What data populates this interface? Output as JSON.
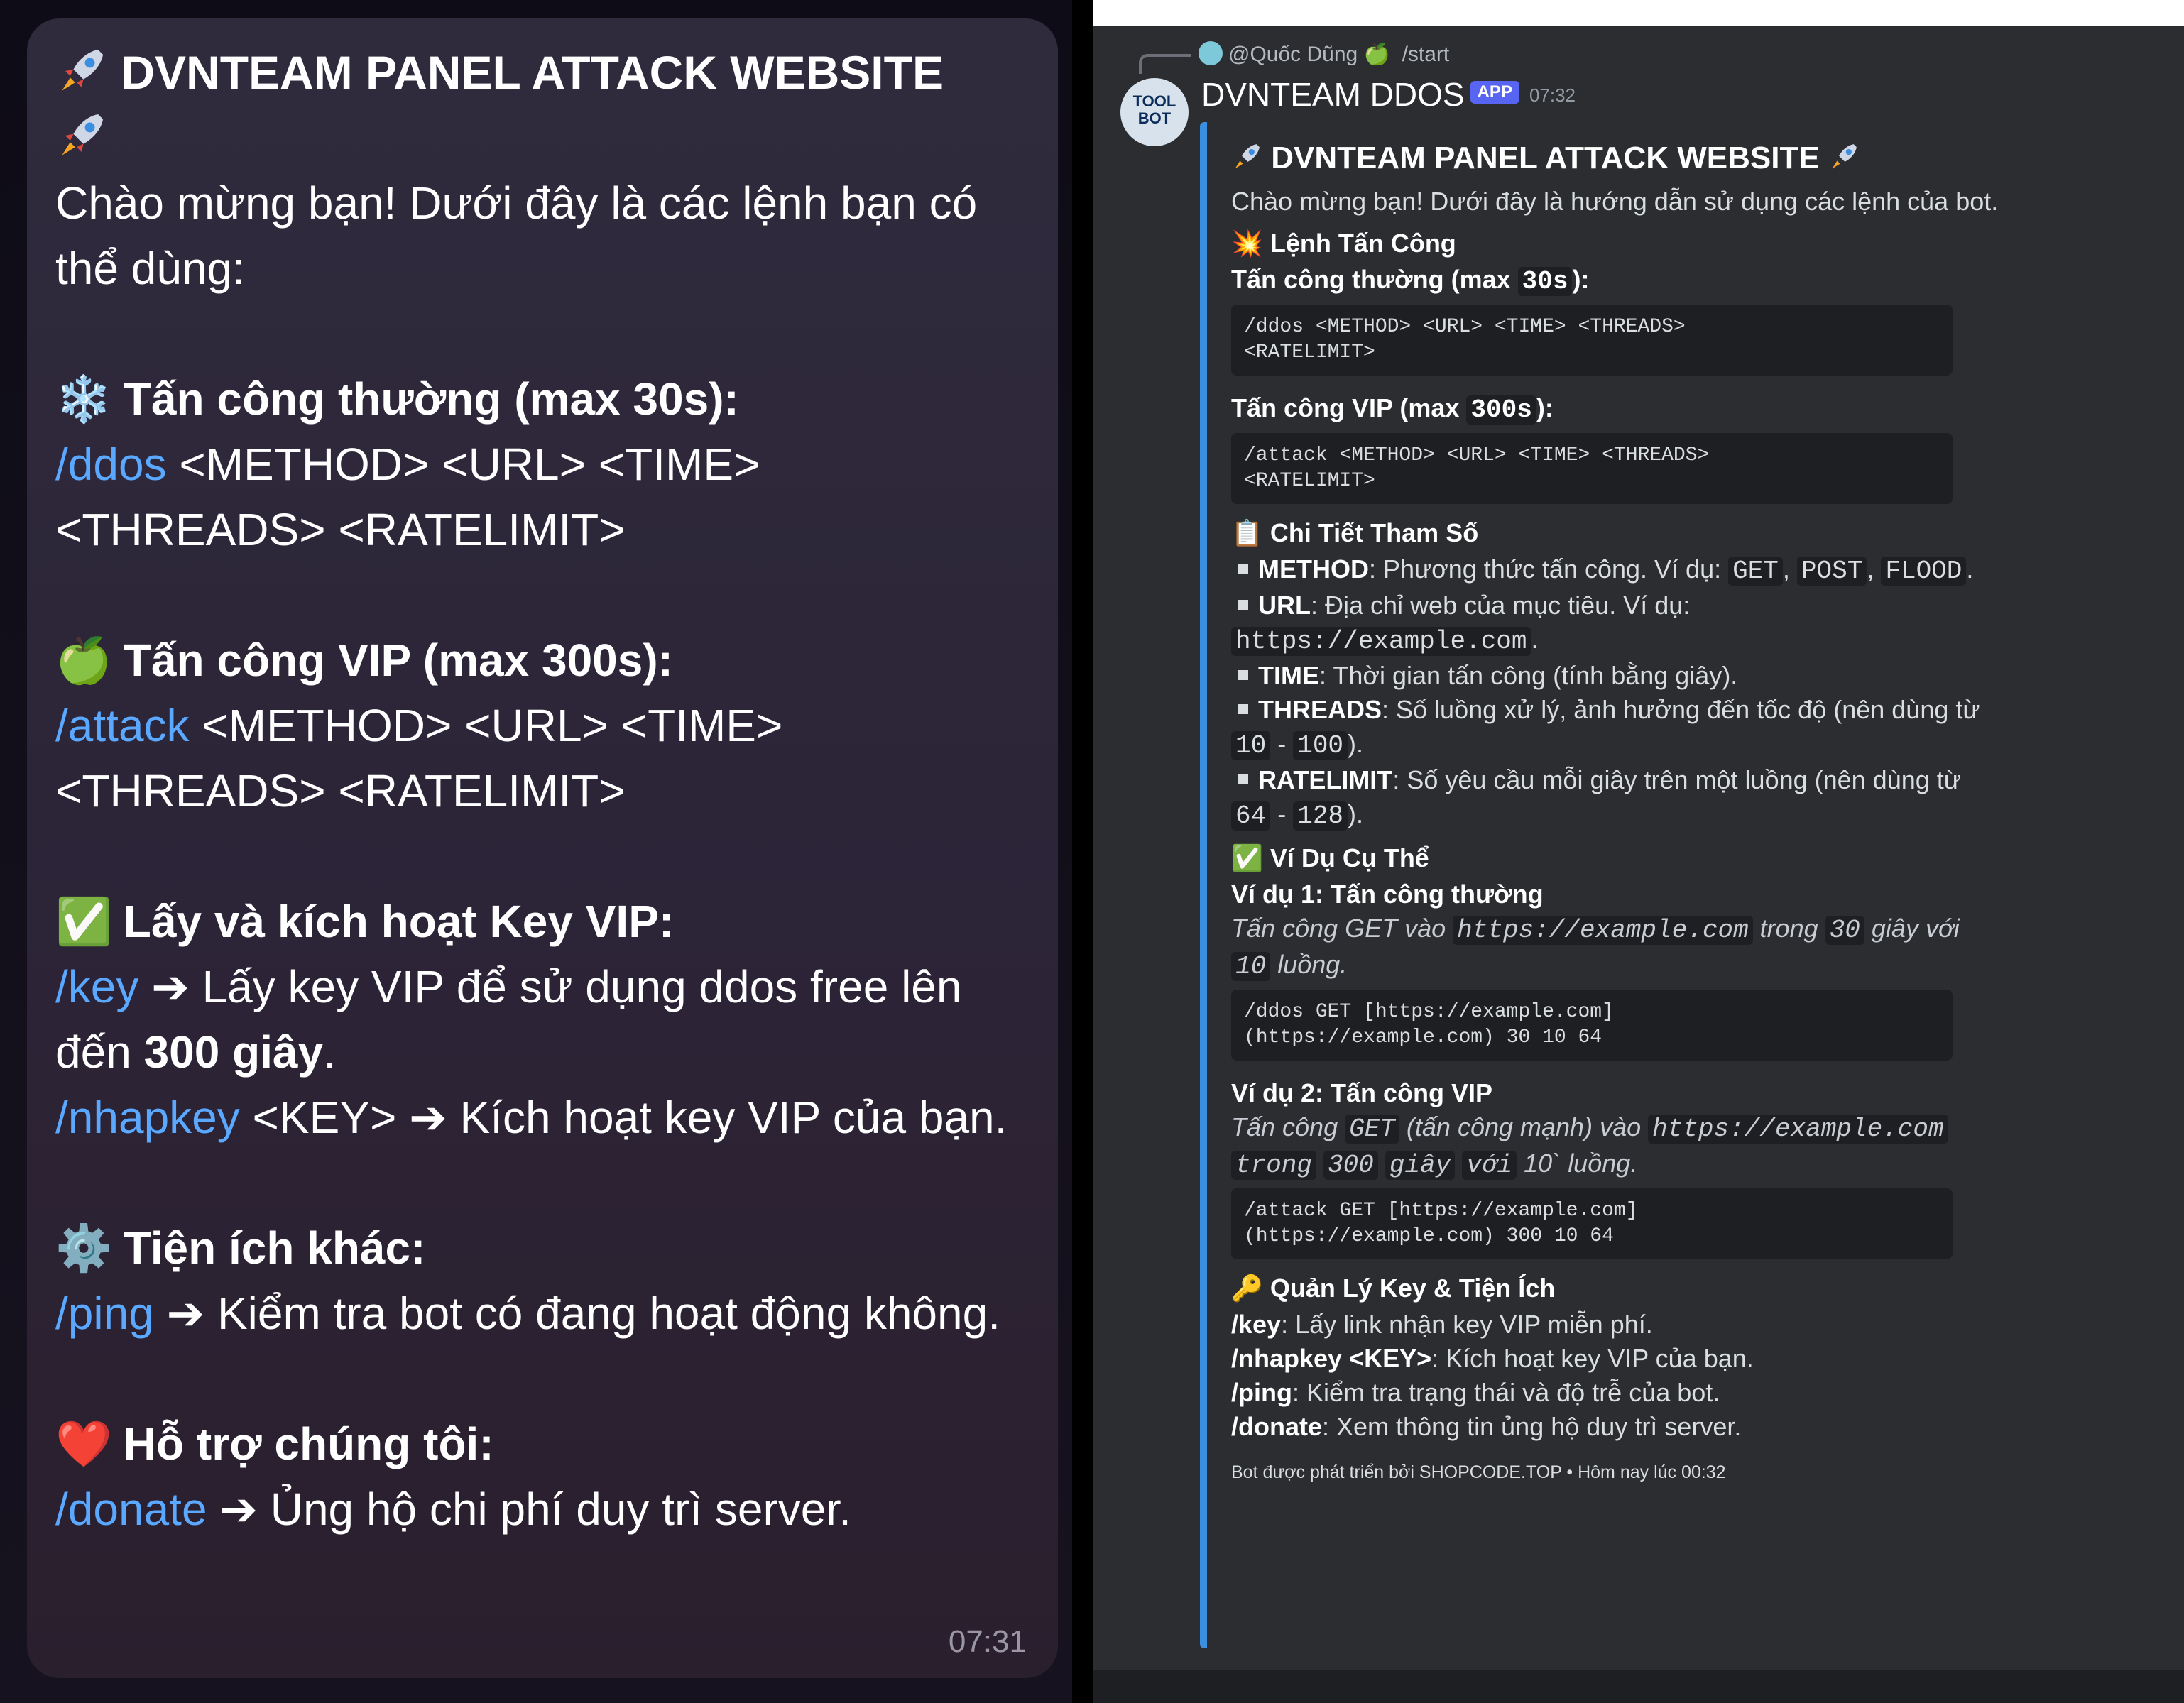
{
  "telegram": {
    "title": "DVNTEAM PANEL ATTACK WEBSITE",
    "intro": "Chào mừng bạn! Dưới đây là các lệnh bạn có thể dùng:",
    "normal": {
      "emoji": "❄️",
      "heading": "Tấn công thường (max 30s):",
      "cmd": "/ddos",
      "args": " <METHOD> <URL> <TIME> <THREADS> <RATELIMIT>"
    },
    "vip": {
      "emoji": "🍏",
      "heading": "Tấn công VIP (max 300s):",
      "cmd": "/attack",
      "args": " <METHOD> <URL> <TIME> <THREADS> <RATELIMIT>"
    },
    "key": {
      "emoji": "✅",
      "heading": "Lấy và kích hoạt Key VIP:",
      "key_cmd": "/key",
      "key_text_a": " ➔ Lấy key VIP để sử dụng ddos free lên đến ",
      "key_bold": "300 giây",
      "key_text_b": ".",
      "nhap_cmd": "/nhapkey",
      "nhap_text": " <KEY> ➔ Kích hoạt key VIP của bạn."
    },
    "util": {
      "emoji": "⚙️",
      "heading": "Tiện ích khác:",
      "cmd": "/ping",
      "text": " ➔ Kiểm tra bot có đang hoạt động không."
    },
    "support": {
      "emoji": "❤️",
      "heading": "Hỗ trợ chúng tôi:",
      "cmd": "/donate",
      "text": " ➔ Ủng hộ chi phí duy trì server."
    },
    "time": "07:31"
  },
  "discord": {
    "reply_user": "@Quốc Dũng 🍏",
    "reply_cmd": "/start",
    "avatar_text_1": "TOOL",
    "avatar_text_2": "BOT",
    "bot_name": "DVNTEAM DDOS",
    "app_badge": "APP",
    "time": "07:32",
    "embed": {
      "title": "DVNTEAM PANEL ATTACK WEBSITE",
      "intro": "Chào mừng bạn! Dưới đây là hướng dẫn sử dụng các lệnh của bot.",
      "attack_heading": "💥 Lệnh Tấn Công",
      "normal_label_a": "Tấn công thường (max ",
      "normal_max": "30s",
      "normal_label_b": "):",
      "normal_code_1": "/ddos <METHOD> <URL> <TIME> <THREADS>",
      "normal_code_2": "<RATELIMIT>",
      "vip_label_a": "Tấn công VIP (max ",
      "vip_max": "300s",
      "vip_label_b": "):",
      "vip_code_1": "/attack <METHOD> <URL> <TIME> <THREADS>",
      "vip_code_2": "<RATELIMIT>",
      "params_heading": "📋 Chi Tiết Tham Số",
      "p_method_k": "METHOD",
      "p_method_v": ": Phương thức tấn công. Ví dụ: ",
      "p_get": "GET",
      "p_post": "POST",
      "p_flood": "FLOOD",
      "p_url_k": "URL",
      "p_url_v": ": Địa chỉ web của mục tiêu. Ví dụ:",
      "p_url_ex": "https://example.com",
      "p_time_k": "TIME",
      "p_time_v": ": Thời gian tấn công (tính bằng giây).",
      "p_threads_k": "THREADS",
      "p_threads_v": ": Số luồng xử lý, ảnh hưởng đến tốc độ (nên dùng từ",
      "p_threads_a": "10",
      "p_threads_b": "100",
      "p_rate_k": "RATELIMIT",
      "p_rate_v": ": Số yêu cầu mỗi giây trên một luồng (nên dùng từ",
      "p_rate_a": "64",
      "p_rate_b": "128",
      "examples_heading": "✅ Ví Dụ Cụ Thể",
      "ex1_title": "Ví dụ 1: Tấn công thường",
      "ex1_a": "Tấn công GET vào ",
      "ex1_url": "https://example.com",
      "ex1_b": " trong ",
      "ex1_time": "30",
      "ex1_c": " giây với",
      "ex1_threads": "10",
      "ex1_d": " luồng.",
      "ex1_code_1": "/ddos GET [https://example.com]",
      "ex1_code_2": "(https://example.com) 30 10 64",
      "ex2_title": "Ví dụ 2: Tấn công VIP",
      "ex2_a": "Tấn công ",
      "ex2_get": "GET",
      "ex2_b": " (tấn công mạnh) vào ",
      "ex2_url": "https://example.com",
      "ex2_c": "trong",
      "ex2_time": "300",
      "ex2_d": "giây",
      "ex2_e": "với",
      "ex2_threads": "10`",
      "ex2_f": "luồng.",
      "ex2_code_1": "/attack GET [https://example.com]",
      "ex2_code_2": "(https://example.com) 300 10 64",
      "keys_heading": "🔑 Quản Lý Key & Tiện Ích",
      "k_key": "/key",
      "k_key_v": ": Lấy link nhận key VIP miễn phí.",
      "k_nhap": "/nhapkey <KEY>",
      "k_nhap_v": ": Kích hoạt key VIP của bạn.",
      "k_ping": "/ping",
      "k_ping_v": ": Kiểm tra trạng thái và độ trễ của bot.",
      "k_donate": "/donate",
      "k_donate_v": ": Xem thông tin ủng hộ duy trì server.",
      "footer": "Bot được phát triển bởi SHOPCODE.TOP • Hôm nay lúc 00:32"
    }
  }
}
